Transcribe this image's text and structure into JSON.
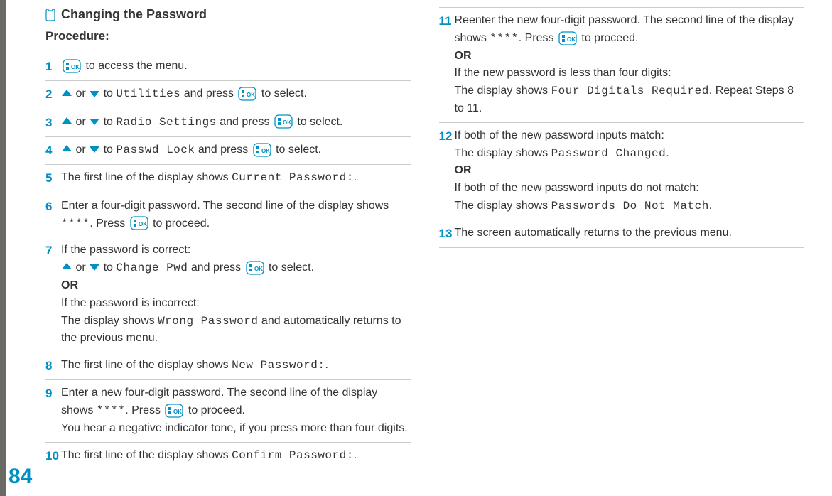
{
  "page_number": "84",
  "heading": "Changing the Password",
  "procedure_label": "Procedure:",
  "text": {
    "or": " or ",
    "OR": "OR",
    "to": " to ",
    "and_press": " and press ",
    "to_select": " to select.",
    "press": ". Press ",
    "to_proceed": " to proceed.",
    "to_access_menu": " to access the menu."
  },
  "mono": {
    "utilities": "Utilities",
    "radio_settings": "Radio Settings",
    "passwd_lock": "Passwd Lock",
    "current_password": "Current Password:",
    "stars": "****",
    "change_pwd": "Change Pwd",
    "wrong_password": "Wrong Password",
    "new_password": "New Password:",
    "confirm_password": "Confirm Password:",
    "four_digitals": "Four Digitals Required",
    "password_changed": "Password Changed",
    "pw_no_match": "Passwords Do Not Match"
  },
  "steps": {
    "s1": "1",
    "s2": "2",
    "s3": "3",
    "s4": "4",
    "s5": "5",
    "s5_text": "The first line of the display shows ",
    "s5_dot": ".",
    "s6": "6",
    "s6_text": "Enter a four-digit password. The second line of the display shows ",
    "s7": "7",
    "s7_a": "If the password is correct:",
    "s7_b": "If the password is incorrect:",
    "s7_c": "The display shows ",
    "s7_d": " and automatically returns to the previous menu.",
    "s8": "8",
    "s8_text": "The first line of the display shows ",
    "s8_dot": ".",
    "s9": "9",
    "s9_text": "Enter a new four-digit password. The second line of the display shows ",
    "s9_tail": "You hear a negative indicator tone, if you press more than four digits.",
    "s10": "10",
    "s10_text": "The first line of the display shows ",
    "s10_dot": ".",
    "s11": "11",
    "s11_text": "Reenter the new four-digit password. The second line of the display shows ",
    "s11_b": "If the new password is less than four digits:",
    "s11_c": "The display shows ",
    "s11_d": ". Repeat Steps 8 to 11.",
    "s12": "12",
    "s12_a": "If both of the new password inputs match:",
    "s12_a2": "The display shows ",
    "s12_a3": ".",
    "s12_b": "If both of the new password inputs do not match:",
    "s12_b2": "The display shows ",
    "s12_b3": ".",
    "s13": "13",
    "s13_text": "The screen automatically returns to the previous menu."
  }
}
